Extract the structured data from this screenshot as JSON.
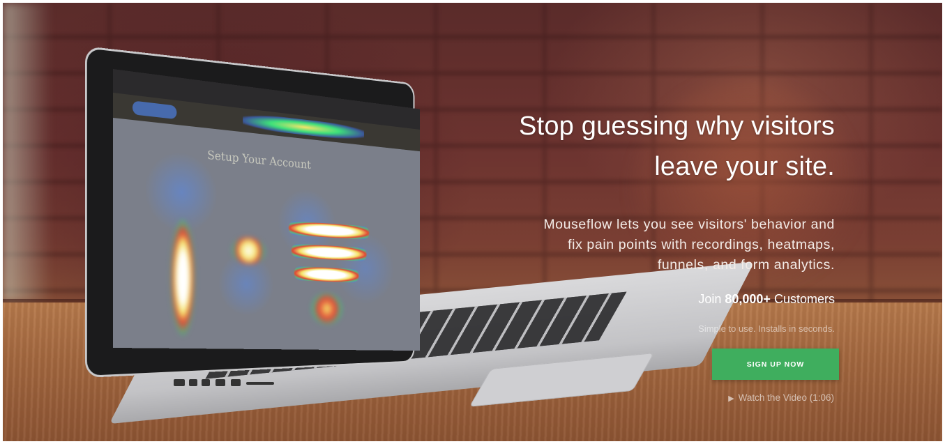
{
  "hero": {
    "headline_line1": "Stop guessing why visitors",
    "headline_line2": "leave your site.",
    "subhead_line1": "Mouseflow lets you see visitors' behavior and",
    "subhead_line2": "fix pain points with recordings, heatmaps,",
    "subhead_line3": "funnels, and form analytics.",
    "join_prefix": "Join",
    "join_count": "80,000+",
    "join_suffix": "Customers",
    "tagline": "Simple to use. Installs in seconds.",
    "cta_label": "SIGN UP NOW",
    "video_label": "Watch the Video (1:06)",
    "video_icon": "play-icon"
  },
  "laptop_screen": {
    "heatmap_title": "Setup Your Account"
  },
  "colors": {
    "cta_green": "#3fae5e",
    "text_white": "#ffffff"
  }
}
